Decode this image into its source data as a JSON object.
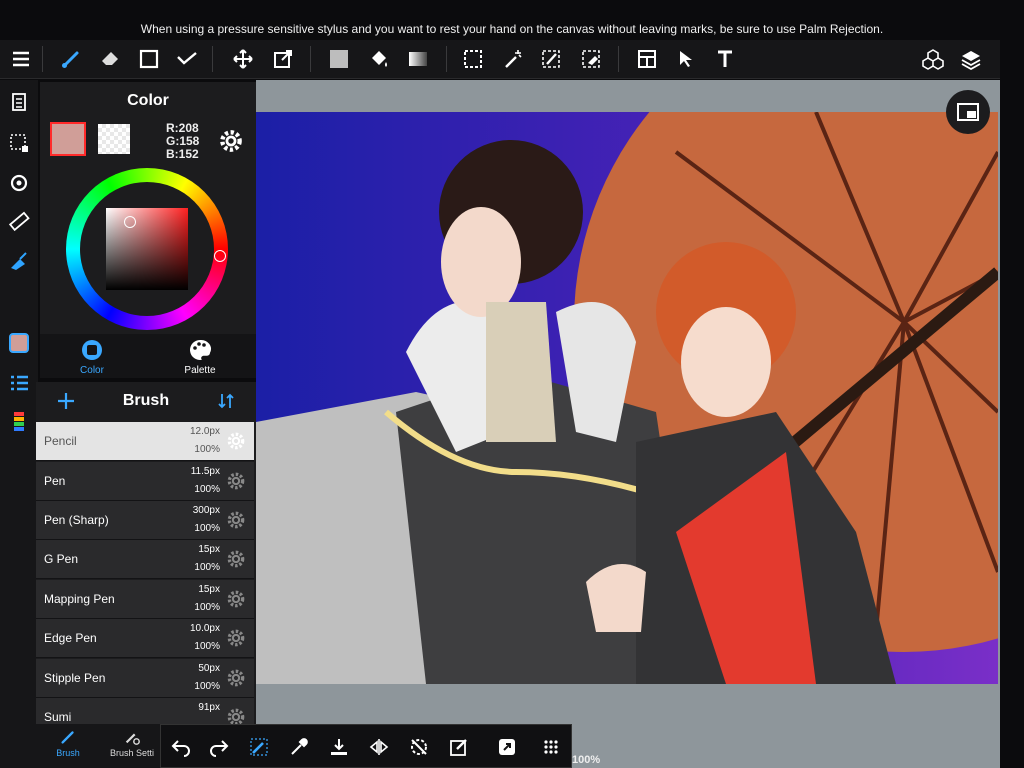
{
  "tip_text": "When using a pressure sensitive stylus and you want to rest your hand on the canvas without leaving marks, be sure to use Palm Rejection.",
  "toolbar": {
    "tools": [
      "menu-icon",
      "brush-tool-icon",
      "eraser-tool-icon",
      "rectangle-tool-icon",
      "select-check-icon",
      "move-icon",
      "transform-icon",
      "fill-color-icon",
      "bucket-icon",
      "gradient-icon",
      "selection-icon",
      "magic-wand-icon",
      "select-pen-icon",
      "select-eraser-icon",
      "layout-icon",
      "pointer-icon",
      "text-icon",
      "3d-material-icon",
      "layers-icon"
    ]
  },
  "color_panel": {
    "title": "Color",
    "r": "R:208",
    "g": "G:158",
    "b": "B:152",
    "fg_color": "#d09e98",
    "tabs": [
      {
        "label": "Color",
        "active": true
      },
      {
        "label": "Palette",
        "active": false
      }
    ]
  },
  "brush_panel": {
    "title": "Brush",
    "items": [
      {
        "name": "Pencil",
        "size": "12.0px",
        "opacity": "100%",
        "selected": true
      },
      {
        "name": "Pen",
        "size": "11.5px",
        "opacity": "100%",
        "selected": false
      },
      {
        "name": "Pen (Sharp)",
        "size": "300px",
        "opacity": "100%",
        "selected": false
      },
      {
        "name": "G Pen",
        "size": "15px",
        "opacity": "100%",
        "selected": false
      },
      {
        "name": "Mapping Pen",
        "size": "15px",
        "opacity": "100%",
        "selected": false
      },
      {
        "name": "Edge Pen",
        "size": "10.0px",
        "opacity": "100%",
        "selected": false
      },
      {
        "name": "Stipple Pen",
        "size": "50px",
        "opacity": "100%",
        "selected": false
      },
      {
        "name": "Sumi",
        "size": "91px",
        "opacity": "",
        "selected": false
      }
    ]
  },
  "bottom_tabs": [
    {
      "label": "Brush"
    },
    {
      "label": "Brush Setti"
    }
  ],
  "zoom": "100%"
}
